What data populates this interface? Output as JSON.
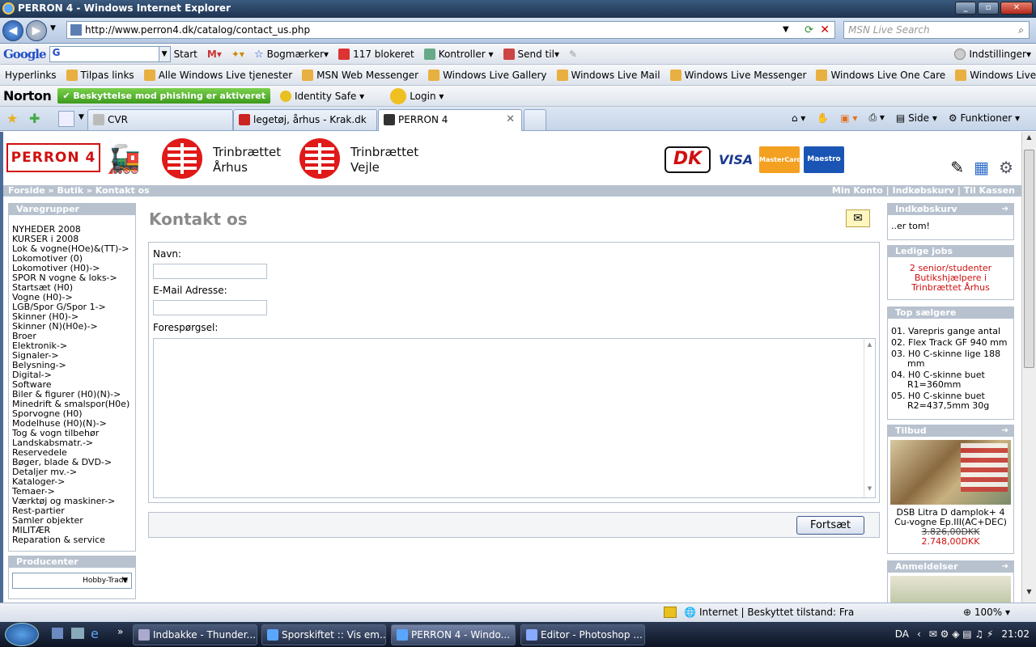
{
  "window": {
    "title": "PERRON 4 - Windows Internet Explorer"
  },
  "address": {
    "url": "http://www.perron4.dk/catalog/contact_us.php",
    "search_placeholder": "MSN Live Search"
  },
  "google_toolbar": {
    "logo": "Google",
    "input_value": "G",
    "start": "Start",
    "bookmarks": "Bogmærker",
    "blocked": "117 blokeret",
    "check": "Kontroller",
    "send": "Send til",
    "settings": "Indstillinger"
  },
  "links_bar": {
    "label": "Hyperlinks",
    "items": [
      "Tilpas links",
      "Alle Windows Live tjenester",
      "MSN Web Messenger",
      "Windows Live Gallery",
      "Windows Live Mail",
      "Windows Live Messenger",
      "Windows Live One Care",
      "Windows Live Spaces"
    ]
  },
  "norton": {
    "logo": "Norton",
    "phishing": "Beskyttelse mod phishing er aktiveret",
    "identity": "Identity Safe",
    "login": "Login"
  },
  "tabs": [
    {
      "label": "CVR"
    },
    {
      "label": "legetøj, århus - Krak.dk"
    },
    {
      "label": "PERRON 4"
    }
  ],
  "tab_tools": {
    "page": "Side",
    "tools": "Funktioner"
  },
  "site": {
    "logo": "PERRON 4",
    "store1_line1": "Trinbrættet",
    "store1_line2": "Århus",
    "store2_line1": "Trinbrættet",
    "store2_line2": "Vejle",
    "pay_dk": "DK",
    "pay_visa": "VISA",
    "pay_mc": "MasterCard",
    "pay_maestro": "Maestro",
    "breadcrumb": "Forside » Butik » Kontakt os",
    "top_links": "Min Konto  |  Indkøbskurv  |  Til Kassen"
  },
  "left": {
    "categories_title": "Varegrupper",
    "categories": [
      "NYHEDER 2008",
      "KURSER i 2008",
      "Lok & vogne(HOe)&(TT)->",
      "Lokomotiver (0)",
      "Lokomotiver (H0)->",
      "SPOR N vogne & loks->",
      "Startsæt (H0)",
      "Vogne (H0)->",
      "LGB/Spor G/Spor 1->",
      "Skinner (H0)->",
      "Skinner (N)(H0e)->",
      "Broer",
      "Elektronik->",
      "Signaler->",
      "Belysning->",
      "Digital->",
      "Software",
      "Biler & figurer (H0)(N)->",
      "Minedrift & smalspor(H0e)",
      "Sporvogne (H0)",
      "Modelhuse (H0)(N)->",
      "Tog & vogn tilbehør",
      "Landskabsmatr.->",
      "Reservedele",
      "Bøger, blade & DVD->",
      "Detaljer mv.->",
      "Kataloger->",
      "Temaer->",
      "Værktøj og maskiner->",
      "Rest-partier",
      "Samler objekter",
      "MILITÆR",
      "Reparation & service"
    ],
    "manufacturers_title": "Producenter",
    "manufacturer_selected": "Hobby-Trade"
  },
  "main": {
    "title": "Kontakt os",
    "name_label": "Navn:",
    "email_label": "E-Mail Adresse:",
    "inquiry_label": "Forespørgsel:",
    "submit": "Fortsæt"
  },
  "right": {
    "cart_title": "Indkøbskurv",
    "cart_body": "..er tom!",
    "jobs_title": "Ledige jobs",
    "jobs_body": "2 senior/studenter Butikshjælpere i Trinbrættet Århus",
    "top_title": "Top sælgere",
    "top_items": [
      "01. Varepris gange antal",
      "02. Flex Track GF 940 mm",
      "03. H0 C-skinne lige 188 mm",
      "04. H0 C-skinne buet R1=360mm",
      "05. H0 C-skinne buet R2=437,5mm 30g"
    ],
    "offer_title": "Tilbud",
    "offer_name": "DSB Litra D damplok+ 4 Cu-vogne Ep.III(AC+DEC)",
    "offer_old": "3.826,00DKK",
    "offer_new": "2.748,00DKK",
    "reviews_title": "Anmeldelser"
  },
  "statusbar": {
    "zone": "Internet | Beskyttet tilstand: Fra",
    "zoom": "100%"
  },
  "taskbar": {
    "buttons": [
      "Indbakke - Thunder...",
      "Sporskiftet :: Vis em...",
      "PERRON 4 - Windo...",
      "Editor - Photoshop ..."
    ],
    "lang": "DA",
    "clock": "21:02"
  },
  "colors": {
    "accent_red": "#d01010",
    "box_header": "#b8c2cf",
    "title_gray": "#8a8a8a"
  }
}
